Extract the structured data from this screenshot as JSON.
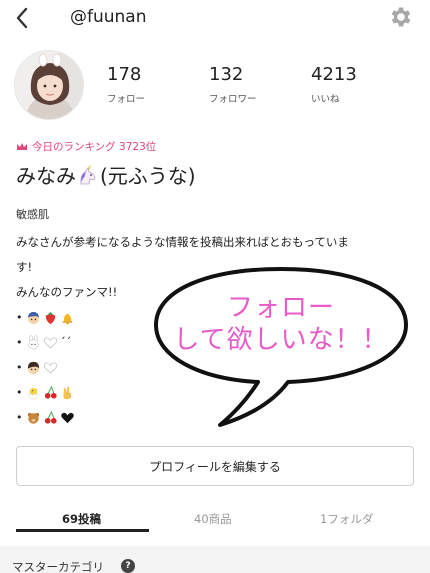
{
  "header": {
    "username": "@fuunan",
    "back_icon": "chevron-left-icon",
    "settings_icon": "gear-icon"
  },
  "profile": {
    "stats": [
      {
        "value": "178",
        "label": "フォロー"
      },
      {
        "value": "132",
        "label": "フォロワー"
      },
      {
        "value": "4213",
        "label": "いいね"
      }
    ],
    "ranking_text": "今日のランキング 3723位",
    "ranking_color": "#e0457b",
    "name_prefix": "みなみ",
    "name_suffix": "(元ふうな)",
    "tag": "敏感肌",
    "bio_lines": [
      "みなさんが参考になるような情報を投稿出来ればとおもっていま",
      "す!",
      "みんなのファンマ!!"
    ],
    "emoji_dot": "•",
    "emoji_tail": "´´"
  },
  "bubble": {
    "line1": "フォロー",
    "line2": "して欲しいな！！",
    "color": "#e85ac8"
  },
  "edit_button": {
    "label": "プロフィールを編集する"
  },
  "tabs": [
    {
      "label": "69投稿",
      "active": true
    },
    {
      "label": "40商品",
      "active": false
    },
    {
      "label": "1フォルダ",
      "active": false
    }
  ],
  "category": {
    "title": "マスターカテゴリ",
    "help": "?"
  }
}
